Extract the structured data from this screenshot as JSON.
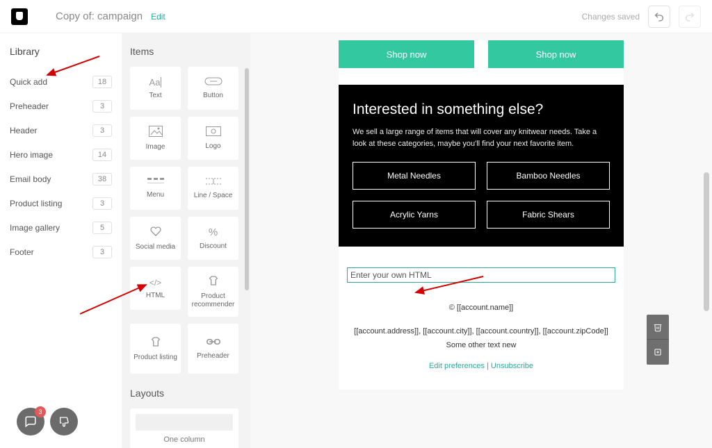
{
  "header": {
    "title": "Copy of: campaign",
    "edit": "Edit",
    "status": "Changes saved"
  },
  "library": {
    "heading": "Library",
    "items": [
      {
        "label": "Quick add",
        "count": "18"
      },
      {
        "label": "Preheader",
        "count": "3"
      },
      {
        "label": "Header",
        "count": "3"
      },
      {
        "label": "Hero image",
        "count": "14"
      },
      {
        "label": "Email body",
        "count": "38"
      },
      {
        "label": "Product listing",
        "count": "3"
      },
      {
        "label": "Image gallery",
        "count": "5"
      },
      {
        "label": "Footer",
        "count": "3"
      }
    ]
  },
  "items_panel": {
    "heading": "Items",
    "tiles": [
      {
        "label": "Text",
        "icon": "Aa|"
      },
      {
        "label": "Button",
        "icon": "button"
      },
      {
        "label": "Image",
        "icon": "image"
      },
      {
        "label": "Logo",
        "icon": "logo"
      },
      {
        "label": "Menu",
        "icon": "menu"
      },
      {
        "label": "Line / Space",
        "icon": "line"
      },
      {
        "label": "Social media",
        "icon": "heart"
      },
      {
        "label": "Discount",
        "icon": "%"
      },
      {
        "label": "HTML",
        "icon": "</>"
      },
      {
        "label": "Product recommender",
        "icon": "shirt"
      },
      {
        "label": "Product listing",
        "icon": "shirt"
      },
      {
        "label": "Preheader",
        "icon": "link"
      }
    ],
    "layouts_heading": "Layouts",
    "layouts": [
      {
        "label": "One column"
      }
    ]
  },
  "email": {
    "cta1": "Shop now",
    "cta2": "Shop now",
    "section_title": "Interested in something else?",
    "section_body": "We sell a large range of items that will cover any knitwear needs. Take a look at these categories, maybe you'll find your next favorite item.",
    "btns": [
      "Metal Needles",
      "Bamboo Needles",
      "Acrylic Yarns",
      "Fabric Shears"
    ],
    "html_placeholder": "Enter your own HTML",
    "footer_line1": "© [[account.name]]",
    "footer_line2": "[[account.address]], [[account.city]], [[account.country]], [[account.zipCode]]",
    "footer_line3": "Some other text new",
    "footer_link1": "Edit preferences",
    "footer_link2": "Unsubscribe"
  },
  "feedback": {
    "badge": "3"
  }
}
